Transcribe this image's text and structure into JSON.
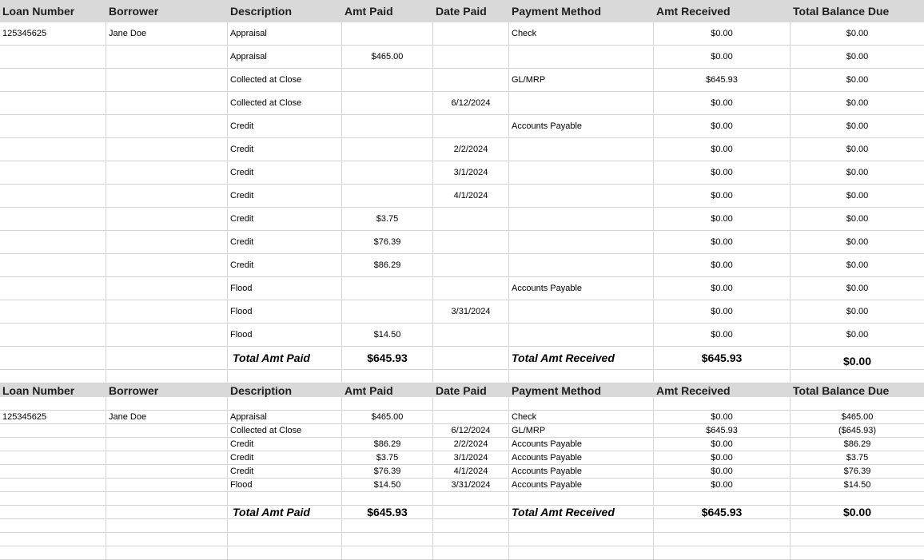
{
  "columns": [
    "Loan Number",
    "Borrower",
    "Description",
    "Amt Paid",
    "Date Paid",
    "Payment Method",
    "Amt Received",
    "Total Balance Due"
  ],
  "table1": {
    "rows": [
      [
        "125345625",
        "Jane Doe",
        "Appraisal",
        "",
        "",
        "Check",
        "$0.00",
        "$0.00"
      ],
      [
        "",
        "",
        "Appraisal",
        "$465.00",
        "",
        "",
        "$0.00",
        "$0.00"
      ],
      [
        "",
        "",
        "Collected at Close",
        "",
        "",
        "GL/MRP",
        "$645.93",
        "$0.00"
      ],
      [
        "",
        "",
        "Collected at Close",
        "",
        "6/12/2024",
        "",
        "$0.00",
        "$0.00"
      ],
      [
        "",
        "",
        "Credit",
        "",
        "",
        "Accounts Payable",
        "$0.00",
        "$0.00"
      ],
      [
        "",
        "",
        "Credit",
        "",
        "2/2/2024",
        "",
        "$0.00",
        "$0.00"
      ],
      [
        "",
        "",
        "Credit",
        "",
        "3/1/2024",
        "",
        "$0.00",
        "$0.00"
      ],
      [
        "",
        "",
        "Credit",
        "",
        "4/1/2024",
        "",
        "$0.00",
        "$0.00"
      ],
      [
        "",
        "",
        "Credit",
        "$3.75",
        "",
        "",
        "$0.00",
        "$0.00"
      ],
      [
        "",
        "",
        "Credit",
        "$76.39",
        "",
        "",
        "$0.00",
        "$0.00"
      ],
      [
        "",
        "",
        "Credit",
        "$86.29",
        "",
        "",
        "$0.00",
        "$0.00"
      ],
      [
        "",
        "",
        "Flood",
        "",
        "",
        "Accounts Payable",
        "$0.00",
        "$0.00"
      ],
      [
        "",
        "",
        "Flood",
        "",
        "3/31/2024",
        "",
        "$0.00",
        "$0.00"
      ],
      [
        "",
        "",
        "Flood",
        "$14.50",
        "",
        "",
        "$0.00",
        "$0.00"
      ]
    ],
    "totals": {
      "paid_label": "Total Amt Paid",
      "paid_value": "$645.93",
      "received_label": "Total Amt Received",
      "received_value": "$645.93",
      "balance_value": "$0.00"
    }
  },
  "table2": {
    "rows": [
      [
        "125345625",
        "Jane Doe",
        "Appraisal",
        "$465.00",
        "",
        "Check",
        "$0.00",
        "$465.00"
      ],
      [
        "",
        "",
        "Collected at Close",
        "",
        "6/12/2024",
        "GL/MRP",
        "$645.93",
        "($645.93)"
      ],
      [
        "",
        "",
        "Credit",
        "$86.29",
        "2/2/2024",
        "Accounts Payable",
        "$0.00",
        "$86.29"
      ],
      [
        "",
        "",
        "Credit",
        "$3.75",
        "3/1/2024",
        "Accounts Payable",
        "$0.00",
        "$3.75"
      ],
      [
        "",
        "",
        "Credit",
        "$76.39",
        "4/1/2024",
        "Accounts Payable",
        "$0.00",
        "$76.39"
      ],
      [
        "",
        "",
        "Flood",
        "$14.50",
        "3/31/2024",
        "Accounts Payable",
        "$0.00",
        "$14.50"
      ]
    ],
    "totals": {
      "paid_label": "Total Amt Paid",
      "paid_value": "$645.93",
      "received_label": "Total Amt Received",
      "received_value": "$645.93",
      "balance_value": "$0.00"
    }
  }
}
